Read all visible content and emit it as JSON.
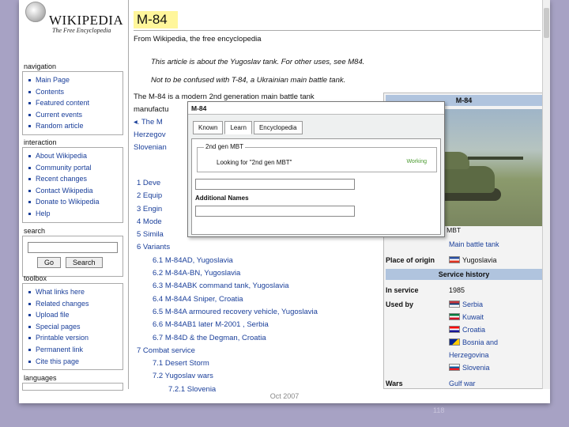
{
  "logo": {
    "title": "WIKIPEDIA",
    "subtitle": "The Free Encyclopedia"
  },
  "navigation": {
    "title": "navigation",
    "items": [
      "Main Page",
      "Contents",
      "Featured content",
      "Current events",
      "Random article"
    ]
  },
  "interaction": {
    "title": "interaction",
    "items": [
      "About Wikipedia",
      "Community portal",
      "Recent changes",
      "Contact Wikipedia",
      "Donate to Wikipedia",
      "Help"
    ]
  },
  "search": {
    "title": "search",
    "go_label": "Go",
    "search_label": "Search"
  },
  "toolbox": {
    "title": "toolbox",
    "items": [
      "What links here",
      "Related changes",
      "Upload file",
      "Special pages",
      "Printable version",
      "Permanent link",
      "Cite this page"
    ]
  },
  "languages": {
    "title": "languages"
  },
  "article": {
    "title": "M-84",
    "from": "From Wikipedia, the free encyclopedia",
    "hatnote1": "This article is about the Yugoslav tank. For other uses, see M84.",
    "hatnote2": "Not to be confused with T-84, a Ukrainian main battle tank.",
    "lead1": "The M-84 is a modern 2nd generation main battle tank",
    "lead2": "manufactu",
    "lead3": "◂. The M",
    "lead4": "Herzegov",
    "lead5": "Slovenian",
    "toc": [
      "1 Deve",
      "2 Equip",
      "3 Engin",
      "4 Mode",
      "5 Simila",
      "6 Variants",
      "6.1 M-84AD, Yugoslavia",
      "6.2 M-84A-BN, Yugoslavia",
      "6.3 M-84ABK command tank, Yugoslavia",
      "6.4 M-84A4 Sniper, Croatia",
      "6.5 M-84A armoured recovery vehicle, Yugoslavia",
      "6.6 M-84AB1 later M-2001 , Serbia",
      "6.7 M-84D & the Degman, Croatia",
      "7 Combat service",
      "7.1 Desert Storm",
      "7.2 Yugoslav wars",
      "7.2.1 Slovenia"
    ]
  },
  "infobox": {
    "header": "M-84",
    "caption": "Serbian Army M-84 MBT",
    "type_val": "Main battle tank",
    "origin_key": "Place of origin",
    "origin_val": "Yugoslavia",
    "service_history": "Service history",
    "in_service_key": "In service",
    "in_service_val": "1985",
    "used_by_key": "Used by",
    "used_by": [
      "Serbia",
      "Kuwait",
      "Croatia",
      "Bosnia and",
      "Herzegovina",
      "Slovenia"
    ],
    "wars_key": "Wars",
    "wars_val": "Gulf war"
  },
  "dialog": {
    "title": "M-84",
    "tabs": [
      "Known",
      "Learn",
      "Encyclopedia"
    ],
    "legend": "2nd gen MBT",
    "looking": "Looking for \"2nd gen MBT\"",
    "status": "Working",
    "additional_names": "Additional Names"
  },
  "slide": {
    "footer": "Oct 2007",
    "number": "118"
  }
}
